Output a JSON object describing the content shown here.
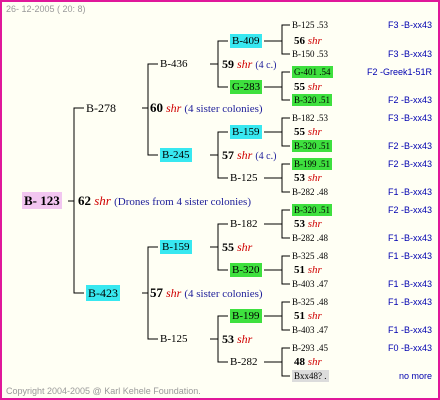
{
  "header": {
    "date": "26- 12-2005 ( 20: 8)"
  },
  "footer": {
    "copyright": "Copyright 2004-2005 @ Karl Kehele Foundation."
  },
  "colors": {
    "border": "#e0189a",
    "cyan": "#38e8f0",
    "green": "#3ee03e",
    "pink": "#f2c6f0",
    "red": "#d00000",
    "blue": "#0000b0"
  },
  "root": {
    "name": "B- 123",
    "queen_num": "62",
    "queen_suffix": "shr",
    "note": "(Drones from 4 sister colonies)"
  },
  "gen1": [
    {
      "name": "B-278",
      "queen_num": "60",
      "queen_suffix": "shr",
      "note": "(4 sister colonies)"
    },
    {
      "name": "B-423",
      "queen_num": "57",
      "queen_suffix": "shr",
      "note": "(4 sister colonies)"
    }
  ],
  "gen2": [
    {
      "name": "B-436",
      "queen_num": "59",
      "queen_suffix": "shr",
      "note": "(4 c.)"
    },
    {
      "name": "B-245",
      "queen_num": "57",
      "queen_suffix": "shr",
      "note": "(4 c.)"
    },
    {
      "name": "B-159",
      "queen_num": "55",
      "queen_suffix": "shr"
    },
    {
      "name": "B-125",
      "queen_num": "53",
      "queen_suffix": "shr"
    }
  ],
  "gen3": [
    {
      "name": "B-409",
      "queen_num": "56",
      "queen_suffix": "shr"
    },
    {
      "name": "G-283",
      "queen_num": "55",
      "queen_suffix": "shr"
    },
    {
      "name": "B-159",
      "queen_num": "55",
      "queen_suffix": "shr"
    },
    {
      "name": "B-125",
      "queen_num": "53",
      "queen_suffix": "shr"
    },
    {
      "name": "B-182",
      "queen_num": "53",
      "queen_suffix": "shr"
    },
    {
      "name": "B-320",
      "queen_num": "51",
      "queen_suffix": "shr"
    },
    {
      "name": "B-199",
      "queen_num": "51",
      "queen_suffix": "shr"
    },
    {
      "name": "B-282",
      "queen_num": "48",
      "queen_suffix": "shr"
    }
  ],
  "gen4": [
    {
      "name": "B-125",
      "val": ".53"
    },
    {
      "name": "B-150",
      "val": ".53"
    },
    {
      "name": "G-401",
      "val": ".54"
    },
    {
      "name": "B-320",
      "val": ".51"
    },
    {
      "name": "B-182",
      "val": ".53"
    },
    {
      "name": "B-320",
      "val": ".51"
    },
    {
      "name": "B-199",
      "val": ".51"
    },
    {
      "name": "B-282",
      "val": ".48"
    },
    {
      "name": "B-320",
      "val": ".51"
    },
    {
      "name": "B-282",
      "val": ".48"
    },
    {
      "name": "B-325",
      "val": ".48"
    },
    {
      "name": "B-403",
      "val": ".47"
    },
    {
      "name": "B-325",
      "val": ".48"
    },
    {
      "name": "B-403",
      "val": ".47"
    },
    {
      "name": "B-293",
      "val": ".45"
    },
    {
      "name": "Bxx48?",
      "val": "."
    }
  ],
  "codes": [
    "F3 -B-xx43",
    "F3 -B-xx43",
    "F2 -Greek1-51R",
    "F2 -B-xx43",
    "F3 -B-xx43",
    "F2 -B-xx43",
    "F2 -B-xx43",
    "F1 -B-xx43",
    "F2 -B-xx43",
    "F1 -B-xx43",
    "F1 -B-xx43",
    "F1 -B-xx43",
    "F1 -B-xx43",
    "F1 -B-xx43",
    "F0 -B-xx43",
    "no more"
  ]
}
